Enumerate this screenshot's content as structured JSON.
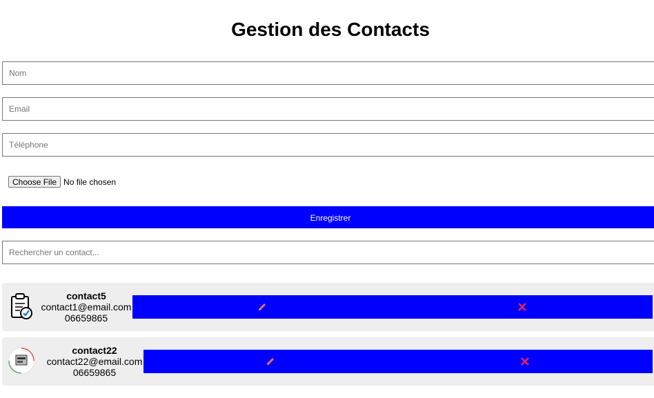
{
  "page": {
    "title": "Gestion des Contacts"
  },
  "form": {
    "name_placeholder": "Nom",
    "email_placeholder": "Email",
    "phone_placeholder": "Téléphone",
    "file_button_label": "Choose File",
    "file_status": "No file chosen",
    "save_label": "Enregistrer"
  },
  "search": {
    "placeholder": "Rechercher un contact..."
  },
  "contacts": [
    {
      "name": "contact5",
      "email": "contact1@email.com",
      "phone": "06659865",
      "avatar_icon": "clipboard-check-icon",
      "edit_icon": "pencil-icon",
      "delete_icon": "close-icon"
    },
    {
      "name": "contact22",
      "email": "contact22@email.com",
      "phone": "06659865",
      "avatar_icon": "logo-avatar-icon",
      "edit_icon": "pencil-icon",
      "delete_icon": "close-icon"
    }
  ],
  "colors": {
    "primary": "#0000ff",
    "card_background": "#eeeeee",
    "edit_icon": "#ff6b6b",
    "delete_icon": "#e0245e"
  }
}
